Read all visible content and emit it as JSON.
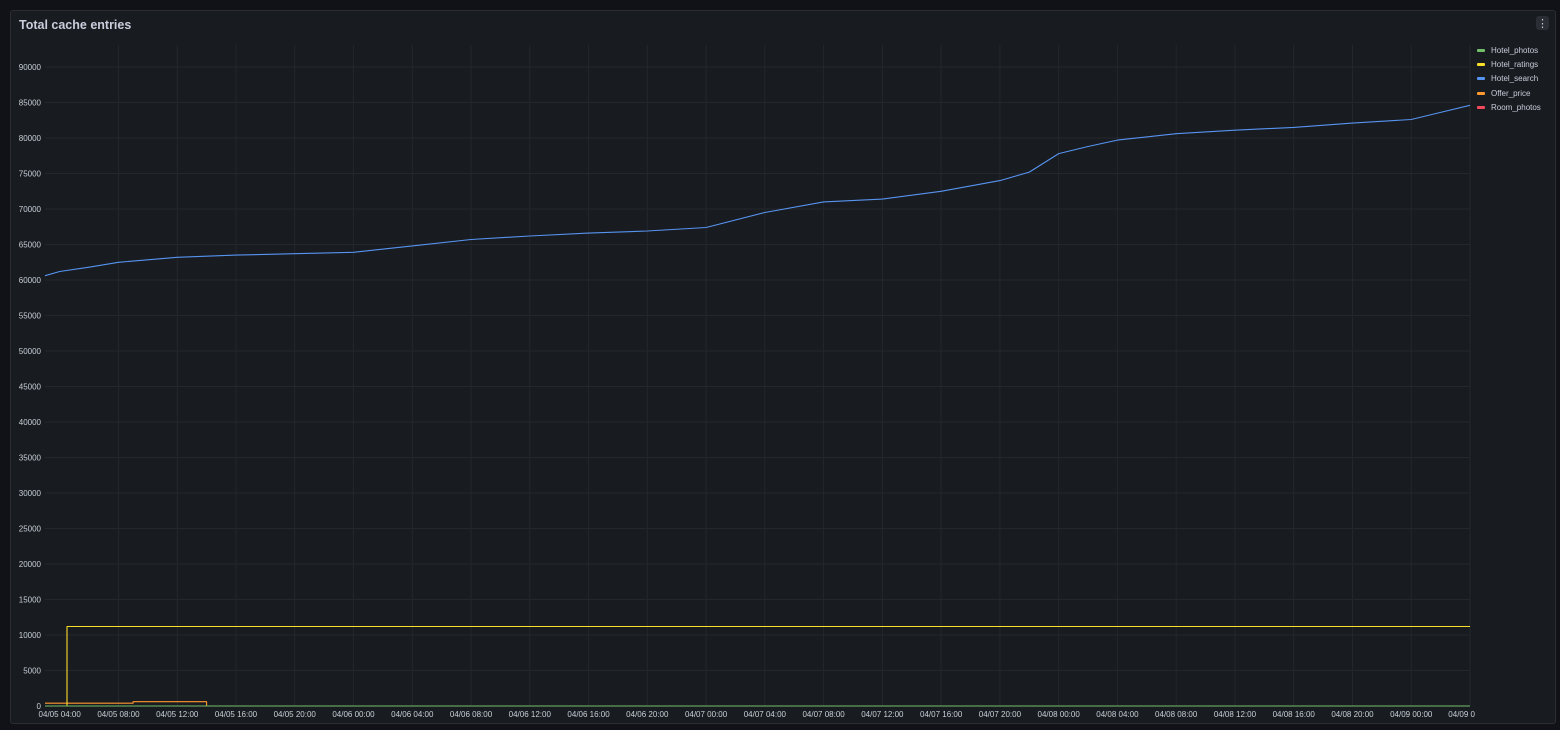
{
  "panel": {
    "title": "Total cache entries"
  },
  "icons": {
    "menu": "more-vertical-icon"
  },
  "chart_data": {
    "type": "line",
    "ylim": [
      0,
      90000
    ],
    "y_ticks": [
      0,
      5000,
      10000,
      15000,
      20000,
      25000,
      30000,
      35000,
      40000,
      45000,
      50000,
      55000,
      60000,
      65000,
      70000,
      75000,
      80000,
      85000,
      90000
    ],
    "x_range": [
      "04/05 03:00",
      "04/09 04:00"
    ],
    "x_tick_labels": [
      "04/05 04:00",
      "04/05 08:00",
      "04/05 12:00",
      "04/05 16:00",
      "04/05 20:00",
      "04/06 00:00",
      "04/06 04:00",
      "04/06 08:00",
      "04/06 12:00",
      "04/06 16:00",
      "04/06 20:00",
      "04/07 00:00",
      "04/07 04:00",
      "04/07 08:00",
      "04/07 12:00",
      "04/07 16:00",
      "04/07 20:00",
      "04/08 00:00",
      "04/08 04:00",
      "04/08 08:00",
      "04/08 12:00",
      "04/08 16:00",
      "04/08 20:00",
      "04/09 00:00",
      "04/09 0"
    ],
    "grid": true,
    "legend_position": "right",
    "series": [
      {
        "name": "Hotel_photos",
        "color": "#73bf69",
        "points": [
          [
            "04/05 03:00",
            0
          ],
          [
            "04/09 04:00",
            0
          ]
        ]
      },
      {
        "name": "Hotel_ratings",
        "color": "#fade2a",
        "points": [
          [
            "04/05 03:00",
            0
          ],
          [
            "04/05 04:30",
            0
          ],
          [
            "04/05 04:30",
            11200
          ],
          [
            "04/09 04:00",
            11200
          ]
        ]
      },
      {
        "name": "Hotel_search",
        "color": "#5794f2",
        "points": [
          [
            "04/05 03:00",
            60600
          ],
          [
            "04/05 04:00",
            61200
          ],
          [
            "04/05 06:00",
            61800
          ],
          [
            "04/05 08:00",
            62500
          ],
          [
            "04/05 12:00",
            63200
          ],
          [
            "04/05 16:00",
            63500
          ],
          [
            "04/05 20:00",
            63700
          ],
          [
            "04/06 00:00",
            63900
          ],
          [
            "04/06 04:00",
            64800
          ],
          [
            "04/06 08:00",
            65700
          ],
          [
            "04/06 12:00",
            66200
          ],
          [
            "04/06 16:00",
            66600
          ],
          [
            "04/06 20:00",
            66900
          ],
          [
            "04/07 00:00",
            67400
          ],
          [
            "04/07 04:00",
            69500
          ],
          [
            "04/07 08:00",
            71000
          ],
          [
            "04/07 12:00",
            71400
          ],
          [
            "04/07 16:00",
            72500
          ],
          [
            "04/07 20:00",
            74000
          ],
          [
            "04/07 22:00",
            75200
          ],
          [
            "04/08 00:00",
            77800
          ],
          [
            "04/08 02:00",
            78800
          ],
          [
            "04/08 04:00",
            79700
          ],
          [
            "04/08 08:00",
            80600
          ],
          [
            "04/08 12:00",
            81100
          ],
          [
            "04/08 16:00",
            81500
          ],
          [
            "04/08 20:00",
            82100
          ],
          [
            "04/09 00:00",
            82600
          ],
          [
            "04/09 02:00",
            83600
          ],
          [
            "04/09 04:00",
            84600
          ]
        ]
      },
      {
        "name": "Offer_price",
        "color": "#ff9830",
        "points": [
          [
            "04/05 03:00",
            400
          ],
          [
            "04/05 09:00",
            400
          ],
          [
            "04/05 09:00",
            600
          ],
          [
            "04/05 14:00",
            600
          ],
          [
            "04/05 14:00",
            0
          ],
          [
            "04/09 04:00",
            0
          ]
        ]
      },
      {
        "name": "Room_photos",
        "color": "#f2495c",
        "points": [
          [
            "04/05 03:00",
            0
          ],
          [
            "04/09 04:00",
            0
          ]
        ]
      }
    ]
  }
}
